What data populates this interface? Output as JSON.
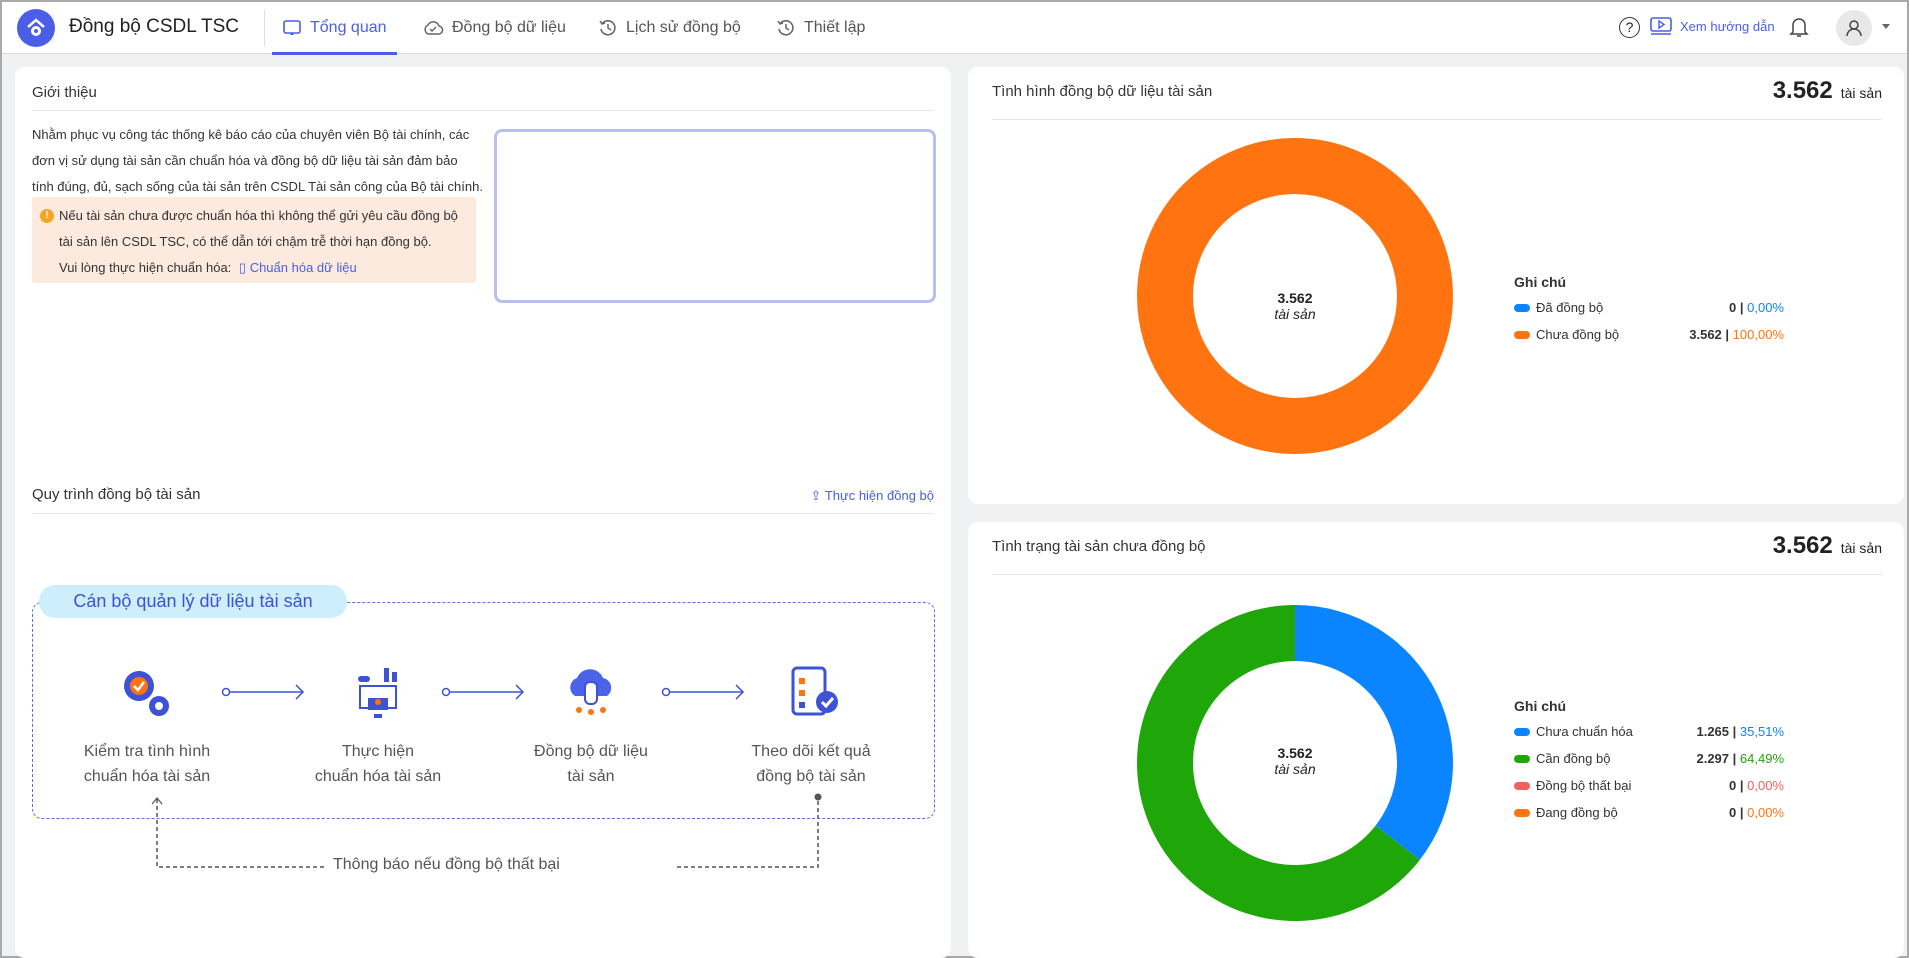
{
  "header": {
    "app_title": "Đồng bộ CSDL TSC",
    "tabs": [
      {
        "label": "Tổng quan",
        "icon": "monitor-icon"
      },
      {
        "label": "Đồng bộ dữ liệu",
        "icon": "cloud-check-icon"
      },
      {
        "label": "Lịch sử đồng bộ",
        "icon": "history-icon"
      },
      {
        "label": "Thiết lập",
        "icon": "history-icon"
      }
    ],
    "guide_label": "Xem hướng dẫn"
  },
  "intro": {
    "title": "Giới thiệu",
    "lines": [
      "Nhằm phục vụ công tác thống kê báo cáo của chuyên viên Bộ tài chính, các",
      "đơn vị sử dụng tài sản cần chuẩn hóa và đồng bộ dữ liệu tài sản đảm bảo",
      "tính đúng, đủ, sạch sống của tài sản trên CSDL Tài sản công của Bộ tài chính."
    ],
    "warning_lines": [
      "Nếu tài sản chưa được chuẩn hóa thì không thể gửi yêu cầu đồng bộ",
      "tài sản lên CSDL TSC, có thể dẫn tới chậm trễ thời hạn đồng bộ."
    ],
    "action_prefix": "Vui lòng thực hiện chuẩn hóa:",
    "action_link": "Chuẩn hóa dữ liệu"
  },
  "process": {
    "title": "Quy trình đồng bộ tài sản",
    "action": "Thực hiện đồng bộ",
    "role": "Cán bộ quản lý dữ liệu tài sản",
    "steps": [
      [
        "Kiểm tra tình hình",
        "chuẩn hóa tài sản"
      ],
      [
        "Thực hiện",
        "chuẩn hóa tài sản"
      ],
      [
        "Đồng bộ dữ liệu",
        "tài sản"
      ],
      [
        "Theo dõi kết quả",
        "đồng bộ tài sản"
      ]
    ],
    "feedback": "Thông báo nếu đồng bộ thất bại"
  },
  "chart_data": [
    {
      "type": "pie",
      "title": "Tình hình đồng bộ dữ liệu tài sản",
      "total": "3.562",
      "unit": "tài sản",
      "legend_title": "Ghi chú",
      "center_value": "3.562",
      "center_unit": "tài sản",
      "categories": [
        "Đã đồng bộ",
        "Chưa đồng bộ"
      ],
      "values": [
        0,
        3562
      ],
      "value_labels": [
        "0",
        "3.562"
      ],
      "percents": [
        "0,00%",
        "100,00%"
      ],
      "colors": [
        "#0a84ff",
        "#ff7410"
      ]
    },
    {
      "type": "pie",
      "title": "Tình trạng tài sản chưa đồng bộ",
      "total": "3.562",
      "unit": "tài sản",
      "legend_title": "Ghi chú",
      "center_value": "3.562",
      "center_unit": "tài sản",
      "categories": [
        "Chưa chuẩn hóa",
        "Cần đồng bộ",
        "Đồng bộ thất bại",
        "Đang đồng bộ"
      ],
      "values": [
        1265,
        2297,
        0,
        0
      ],
      "value_labels": [
        "1.265",
        "2.297",
        "0",
        "0"
      ],
      "percents": [
        "35,51%",
        "64,49%",
        "0,00%",
        "0,00%"
      ],
      "colors": [
        "#0a84ff",
        "#1fa70a",
        "#f0605f",
        "#ff7410"
      ]
    }
  ]
}
